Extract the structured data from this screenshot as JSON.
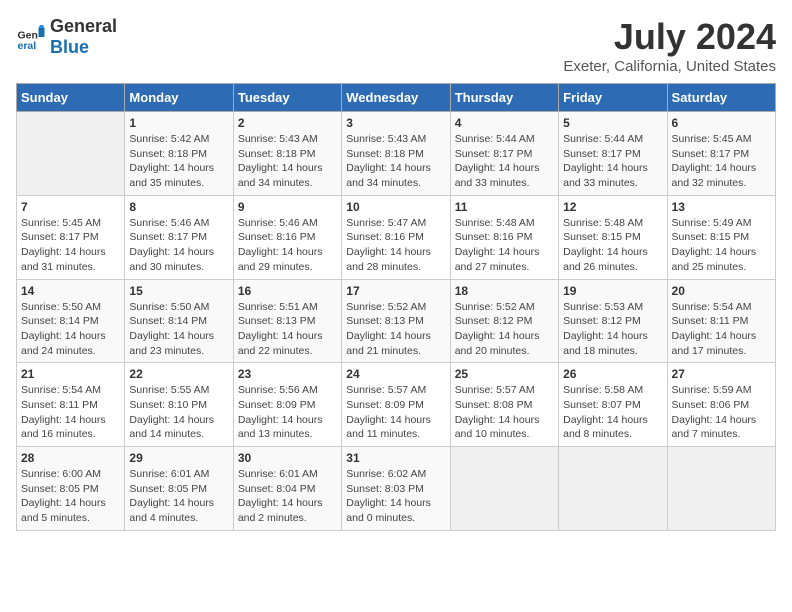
{
  "app": {
    "logo_general": "General",
    "logo_blue": "Blue",
    "title": "July 2024",
    "subtitle": "Exeter, California, United States"
  },
  "calendar": {
    "days_of_week": [
      "Sunday",
      "Monday",
      "Tuesday",
      "Wednesday",
      "Thursday",
      "Friday",
      "Saturday"
    ],
    "weeks": [
      [
        {
          "day": "",
          "empty": true
        },
        {
          "day": "1",
          "line1": "Sunrise: 5:42 AM",
          "line2": "Sunset: 8:18 PM",
          "line3": "Daylight: 14 hours",
          "line4": "and 35 minutes."
        },
        {
          "day": "2",
          "line1": "Sunrise: 5:43 AM",
          "line2": "Sunset: 8:18 PM",
          "line3": "Daylight: 14 hours",
          "line4": "and 34 minutes."
        },
        {
          "day": "3",
          "line1": "Sunrise: 5:43 AM",
          "line2": "Sunset: 8:18 PM",
          "line3": "Daylight: 14 hours",
          "line4": "and 34 minutes."
        },
        {
          "day": "4",
          "line1": "Sunrise: 5:44 AM",
          "line2": "Sunset: 8:17 PM",
          "line3": "Daylight: 14 hours",
          "line4": "and 33 minutes."
        },
        {
          "day": "5",
          "line1": "Sunrise: 5:44 AM",
          "line2": "Sunset: 8:17 PM",
          "line3": "Daylight: 14 hours",
          "line4": "and 33 minutes."
        },
        {
          "day": "6",
          "line1": "Sunrise: 5:45 AM",
          "line2": "Sunset: 8:17 PM",
          "line3": "Daylight: 14 hours",
          "line4": "and 32 minutes."
        }
      ],
      [
        {
          "day": "7",
          "line1": "Sunrise: 5:45 AM",
          "line2": "Sunset: 8:17 PM",
          "line3": "Daylight: 14 hours",
          "line4": "and 31 minutes."
        },
        {
          "day": "8",
          "line1": "Sunrise: 5:46 AM",
          "line2": "Sunset: 8:17 PM",
          "line3": "Daylight: 14 hours",
          "line4": "and 30 minutes."
        },
        {
          "day": "9",
          "line1": "Sunrise: 5:46 AM",
          "line2": "Sunset: 8:16 PM",
          "line3": "Daylight: 14 hours",
          "line4": "and 29 minutes."
        },
        {
          "day": "10",
          "line1": "Sunrise: 5:47 AM",
          "line2": "Sunset: 8:16 PM",
          "line3": "Daylight: 14 hours",
          "line4": "and 28 minutes."
        },
        {
          "day": "11",
          "line1": "Sunrise: 5:48 AM",
          "line2": "Sunset: 8:16 PM",
          "line3": "Daylight: 14 hours",
          "line4": "and 27 minutes."
        },
        {
          "day": "12",
          "line1": "Sunrise: 5:48 AM",
          "line2": "Sunset: 8:15 PM",
          "line3": "Daylight: 14 hours",
          "line4": "and 26 minutes."
        },
        {
          "day": "13",
          "line1": "Sunrise: 5:49 AM",
          "line2": "Sunset: 8:15 PM",
          "line3": "Daylight: 14 hours",
          "line4": "and 25 minutes."
        }
      ],
      [
        {
          "day": "14",
          "line1": "Sunrise: 5:50 AM",
          "line2": "Sunset: 8:14 PM",
          "line3": "Daylight: 14 hours",
          "line4": "and 24 minutes."
        },
        {
          "day": "15",
          "line1": "Sunrise: 5:50 AM",
          "line2": "Sunset: 8:14 PM",
          "line3": "Daylight: 14 hours",
          "line4": "and 23 minutes."
        },
        {
          "day": "16",
          "line1": "Sunrise: 5:51 AM",
          "line2": "Sunset: 8:13 PM",
          "line3": "Daylight: 14 hours",
          "line4": "and 22 minutes."
        },
        {
          "day": "17",
          "line1": "Sunrise: 5:52 AM",
          "line2": "Sunset: 8:13 PM",
          "line3": "Daylight: 14 hours",
          "line4": "and 21 minutes."
        },
        {
          "day": "18",
          "line1": "Sunrise: 5:52 AM",
          "line2": "Sunset: 8:12 PM",
          "line3": "Daylight: 14 hours",
          "line4": "and 20 minutes."
        },
        {
          "day": "19",
          "line1": "Sunrise: 5:53 AM",
          "line2": "Sunset: 8:12 PM",
          "line3": "Daylight: 14 hours",
          "line4": "and 18 minutes."
        },
        {
          "day": "20",
          "line1": "Sunrise: 5:54 AM",
          "line2": "Sunset: 8:11 PM",
          "line3": "Daylight: 14 hours",
          "line4": "and 17 minutes."
        }
      ],
      [
        {
          "day": "21",
          "line1": "Sunrise: 5:54 AM",
          "line2": "Sunset: 8:11 PM",
          "line3": "Daylight: 14 hours",
          "line4": "and 16 minutes."
        },
        {
          "day": "22",
          "line1": "Sunrise: 5:55 AM",
          "line2": "Sunset: 8:10 PM",
          "line3": "Daylight: 14 hours",
          "line4": "and 14 minutes."
        },
        {
          "day": "23",
          "line1": "Sunrise: 5:56 AM",
          "line2": "Sunset: 8:09 PM",
          "line3": "Daylight: 14 hours",
          "line4": "and 13 minutes."
        },
        {
          "day": "24",
          "line1": "Sunrise: 5:57 AM",
          "line2": "Sunset: 8:09 PM",
          "line3": "Daylight: 14 hours",
          "line4": "and 11 minutes."
        },
        {
          "day": "25",
          "line1": "Sunrise: 5:57 AM",
          "line2": "Sunset: 8:08 PM",
          "line3": "Daylight: 14 hours",
          "line4": "and 10 minutes."
        },
        {
          "day": "26",
          "line1": "Sunrise: 5:58 AM",
          "line2": "Sunset: 8:07 PM",
          "line3": "Daylight: 14 hours",
          "line4": "and 8 minutes."
        },
        {
          "day": "27",
          "line1": "Sunrise: 5:59 AM",
          "line2": "Sunset: 8:06 PM",
          "line3": "Daylight: 14 hours",
          "line4": "and 7 minutes."
        }
      ],
      [
        {
          "day": "28",
          "line1": "Sunrise: 6:00 AM",
          "line2": "Sunset: 8:05 PM",
          "line3": "Daylight: 14 hours",
          "line4": "and 5 minutes."
        },
        {
          "day": "29",
          "line1": "Sunrise: 6:01 AM",
          "line2": "Sunset: 8:05 PM",
          "line3": "Daylight: 14 hours",
          "line4": "and 4 minutes."
        },
        {
          "day": "30",
          "line1": "Sunrise: 6:01 AM",
          "line2": "Sunset: 8:04 PM",
          "line3": "Daylight: 14 hours",
          "line4": "and 2 minutes."
        },
        {
          "day": "31",
          "line1": "Sunrise: 6:02 AM",
          "line2": "Sunset: 8:03 PM",
          "line3": "Daylight: 14 hours",
          "line4": "and 0 minutes."
        },
        {
          "day": "",
          "empty": true
        },
        {
          "day": "",
          "empty": true
        },
        {
          "day": "",
          "empty": true
        }
      ]
    ]
  }
}
